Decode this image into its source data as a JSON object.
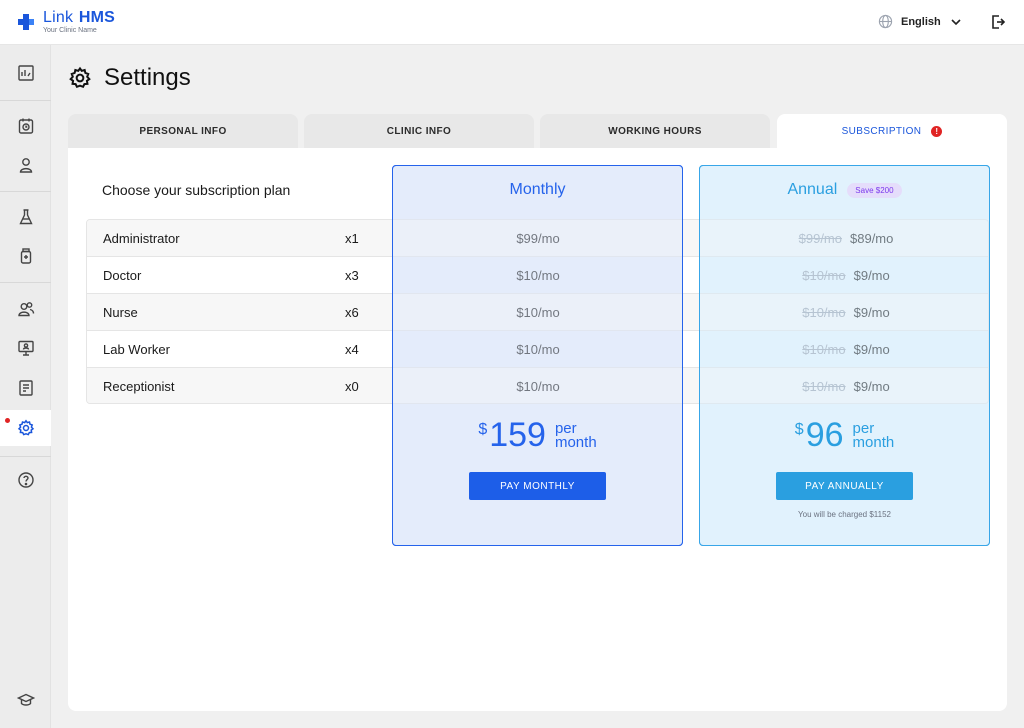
{
  "app": {
    "title_bold": "Link",
    "title_rest": "HMS",
    "subtitle": "Your Clinic Name"
  },
  "header": {
    "language": "English"
  },
  "page": {
    "title": "Settings"
  },
  "tabs": [
    {
      "label": "PERSONAL INFO"
    },
    {
      "label": "CLINIC INFO"
    },
    {
      "label": "WORKING HOURS"
    },
    {
      "label": "SUBSCRIPTION",
      "alert": "!"
    }
  ],
  "subscription": {
    "heading": "Choose your subscription plan",
    "monthly": {
      "title": "Monthly",
      "currency": "$",
      "total": "159",
      "per": "per",
      "period": "month",
      "button": "PAY MONTHLY"
    },
    "annual": {
      "title": "Annual",
      "badge": "Save $200",
      "currency": "$",
      "total": "96",
      "per": "per",
      "period": "month",
      "button": "PAY ANNUALLY",
      "note": "You will be charged $1152"
    },
    "rows": [
      {
        "role": "Administrator",
        "qty": "x1",
        "monthly": "$99/mo",
        "annual_old": "$99/mo",
        "annual": "$89/mo"
      },
      {
        "role": "Doctor",
        "qty": "x3",
        "monthly": "$10/mo",
        "annual_old": "$10/mo",
        "annual": "$9/mo"
      },
      {
        "role": "Nurse",
        "qty": "x6",
        "monthly": "$10/mo",
        "annual_old": "$10/mo",
        "annual": "$9/mo"
      },
      {
        "role": "Lab Worker",
        "qty": "x4",
        "monthly": "$10/mo",
        "annual_old": "$10/mo",
        "annual": "$9/mo"
      },
      {
        "role": "Receptionist",
        "qty": "x0",
        "monthly": "$10/mo",
        "annual_old": "$10/mo",
        "annual": "$9/mo"
      }
    ]
  },
  "colors": {
    "primary": "#2563eb",
    "annual": "#2a9fe0",
    "alert": "#e02424",
    "badge": "#7c3aed"
  },
  "icons": {
    "sidebar": [
      "dashboard-icon",
      "appointments-icon",
      "patients-icon",
      "lab-icon",
      "pharmacy-icon",
      "staff-icon",
      "monitor-icon",
      "reports-icon",
      "settings-icon",
      "help-icon",
      "education-icon"
    ]
  }
}
